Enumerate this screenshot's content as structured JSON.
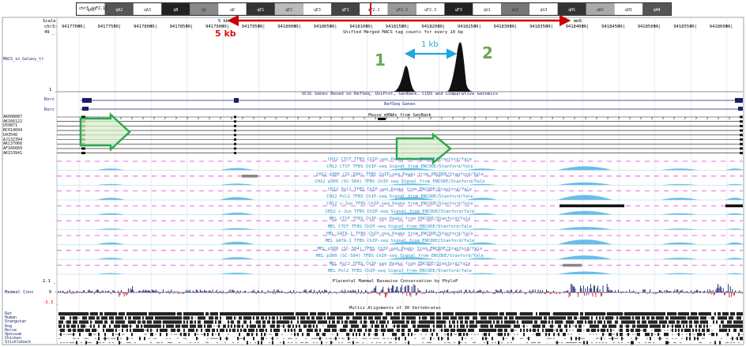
{
  "ideogram": {
    "chrom_label": "chr3 (qF2.1)",
    "bands": [
      "qA1",
      "qA2",
      "qA3",
      "qB",
      "qC",
      "qD",
      "qE1",
      "qE2",
      "qE3",
      "qF1",
      "qF2.1",
      "qF2.2",
      "qF2.3",
      "qF3",
      "qG1",
      "qG2",
      "qG3",
      "qH1",
      "qH2",
      "qH3",
      "qH4"
    ]
  },
  "ruler": {
    "scale_label": "Scale",
    "chrom_label": "chr3:",
    "num_label": "49 _",
    "scale_text": "5 kb",
    "scale_suffix": "mm9",
    "positions": [
      "94177000|",
      "94177500|",
      "94178000|",
      "94178500|",
      "94179000|",
      "94179500|",
      "94180000|",
      "94180500|",
      "94181000|",
      "94181500|",
      "94182000|",
      "94182500|",
      "94183000|",
      "94183500|",
      "94184000|",
      "94184500|",
      "94185000|",
      "94185500|",
      "94186000|"
    ]
  },
  "annotations": {
    "five_kb": "5 kb",
    "one_kb": "1 kb",
    "peak1": "1",
    "peak2": "2"
  },
  "left_labels": {
    "macs": "MACS_in_Galaxy_tr",
    "one": "1 _",
    "rorc1": "Rorc",
    "rorc2": "Rorc",
    "mrnas": [
      "AK008087",
      "AK166122",
      "U59871",
      "BC014604",
      "U43540",
      "AJ132394",
      "AK137066",
      "AF166660",
      "AK153941"
    ],
    "range_top": "2.1 _",
    "mammal": "Mammal Cons",
    "zero": "0 -",
    "range_bottom": "-3.3 _",
    "species": [
      "Rat",
      "Human",
      "Orangutan",
      "Dog",
      "Horse",
      "Opossum",
      "Chicken",
      "Stickleback"
    ]
  },
  "track_titles": {
    "macs": "Shifted Merged MACS tag counts for every 10 bp",
    "ucsc_genes": "UCSC Genes Based on RefSeq, UniProt, GenBank, CCDS and Comparative Genomics",
    "refseq": "RefSeq Genes",
    "mrna": "Mouse mRNAs from GenBank",
    "encode": [
      "CH12 CTCF TFBS ChIP-seq Peaks from ENCODE/Stanford/Yale",
      "CH12 CTCF TFBS ChIP-seq Signal from ENCODE/Stanford/Yale",
      "CH12 p300 (SC-584) TFBS ChIP-seq Peaks from ENCODE/Stanford/Yale",
      "CH12 p300 (SC-584) TFBS ChIP-seq Signal from ENCODE/Stanford/Yale",
      "CH12 Pol2 TFBS ChIP-seq Peaks from ENCODE/Stanford/Yale",
      "CH12 Pol2 TFBS ChIP-seq Signal from ENCODE/Stanford/Yale",
      "CH12 c-Jun TFBS ChIP-seq Peaks from ENCODE/Stanford/Yale",
      "CH12 c-Jun TFBS ChIP-seq Signal from ENCODE/Stanford/Yale",
      "MEL CTCF TFBS ChIP-seq Peaks from ENCODE/Stanford/Yale",
      "MEL CTCF TFBS ChIP-seq Signal from ENCODE/Stanford/Yale",
      "MEL GATA-1 TFBS ChIP-seq Peaks from ENCODE/Stanford/Yale",
      "MEL GATA-1 TFBS ChIP-seq Signal from ENCODE/Stanford/Yale",
      "MEL p300 (SC-584) TFBS ChIP-seq Peaks from ENCODE/Stanford/Yale",
      "MEL p300 (SC-584) TFBS ChIP-seq Signal from ENCODE/Stanford/Yale",
      "MEL Pol2 TFBS ChIP-seq Peaks from ENCODE/Stanford/Yale",
      "MEL Pol2 TFBS ChIP-seq Signal from ENCODE/Stanford/Yale"
    ],
    "conservation": "Placental Mammal Basewise Conservation by PhyloP",
    "multiz": "Multiz Alignments of 30 Vertebrates"
  },
  "colors": {
    "encode_signal": "#4fb3e6",
    "encode_title": "#2f8fc4",
    "gene": "#1a1f6b",
    "red_arrow": "#cc0000",
    "one_kb_arrow": "#1ea7e0",
    "green_arrow": "#2ea84f",
    "peak": "#111111"
  },
  "icons": {
    "five_kb_arrow": "double-arrow-icon",
    "one_kb_arrow": "double-arrow-icon",
    "promoter_arrow_1": "block-arrow-icon",
    "promoter_arrow_2": "block-arrow-icon"
  }
}
